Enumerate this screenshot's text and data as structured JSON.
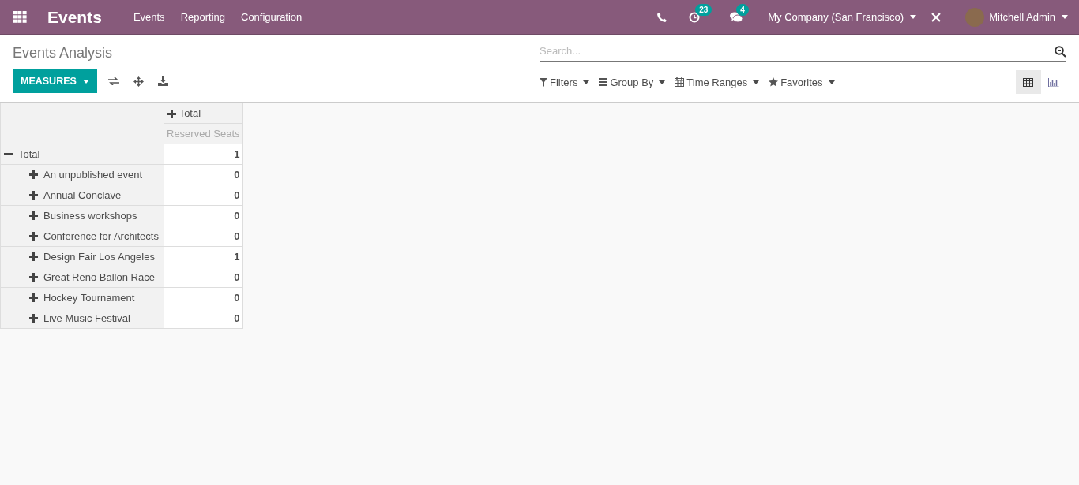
{
  "navbar": {
    "app_title": "Events",
    "menu": [
      "Events",
      "Reporting",
      "Configuration"
    ],
    "activity_count": "23",
    "message_count": "4",
    "company": "My Company (San Francisco)",
    "user": "Mitchell Admin"
  },
  "control_panel": {
    "breadcrumb": "Events Analysis",
    "search": {
      "placeholder": "Search..."
    },
    "measures_button": "MEASURES",
    "filters": [
      {
        "kind": "filter",
        "label": "Filters"
      },
      {
        "kind": "groupby",
        "label": "Group By"
      },
      {
        "kind": "time",
        "label": "Time Ranges"
      },
      {
        "kind": "favorites",
        "label": "Favorites"
      }
    ],
    "views": [
      {
        "kind": "pivot",
        "selected": true
      },
      {
        "kind": "graph",
        "selected": false
      }
    ]
  },
  "pivot": {
    "column_header": {
      "label": "Total",
      "expanded": false
    },
    "measure": "Reserved Seats",
    "rows": [
      {
        "label": "Total",
        "value": "1",
        "expanded": true,
        "children": [
          {
            "label": "An unpublished event",
            "value": "0",
            "expanded": false
          },
          {
            "label": "Annual Conclave",
            "value": "0",
            "expanded": false
          },
          {
            "label": "Business workshops",
            "value": "0",
            "expanded": false
          },
          {
            "label": "Conference for Architects",
            "value": "0",
            "expanded": false
          },
          {
            "label": "Design Fair Los Angeles",
            "value": "1",
            "expanded": false
          },
          {
            "label": "Great Reno Ballon Race",
            "value": "0",
            "expanded": false
          },
          {
            "label": "Hockey Tournament",
            "value": "0",
            "expanded": false
          },
          {
            "label": "Live Music Festival",
            "value": "0",
            "expanded": false
          }
        ]
      }
    ]
  }
}
